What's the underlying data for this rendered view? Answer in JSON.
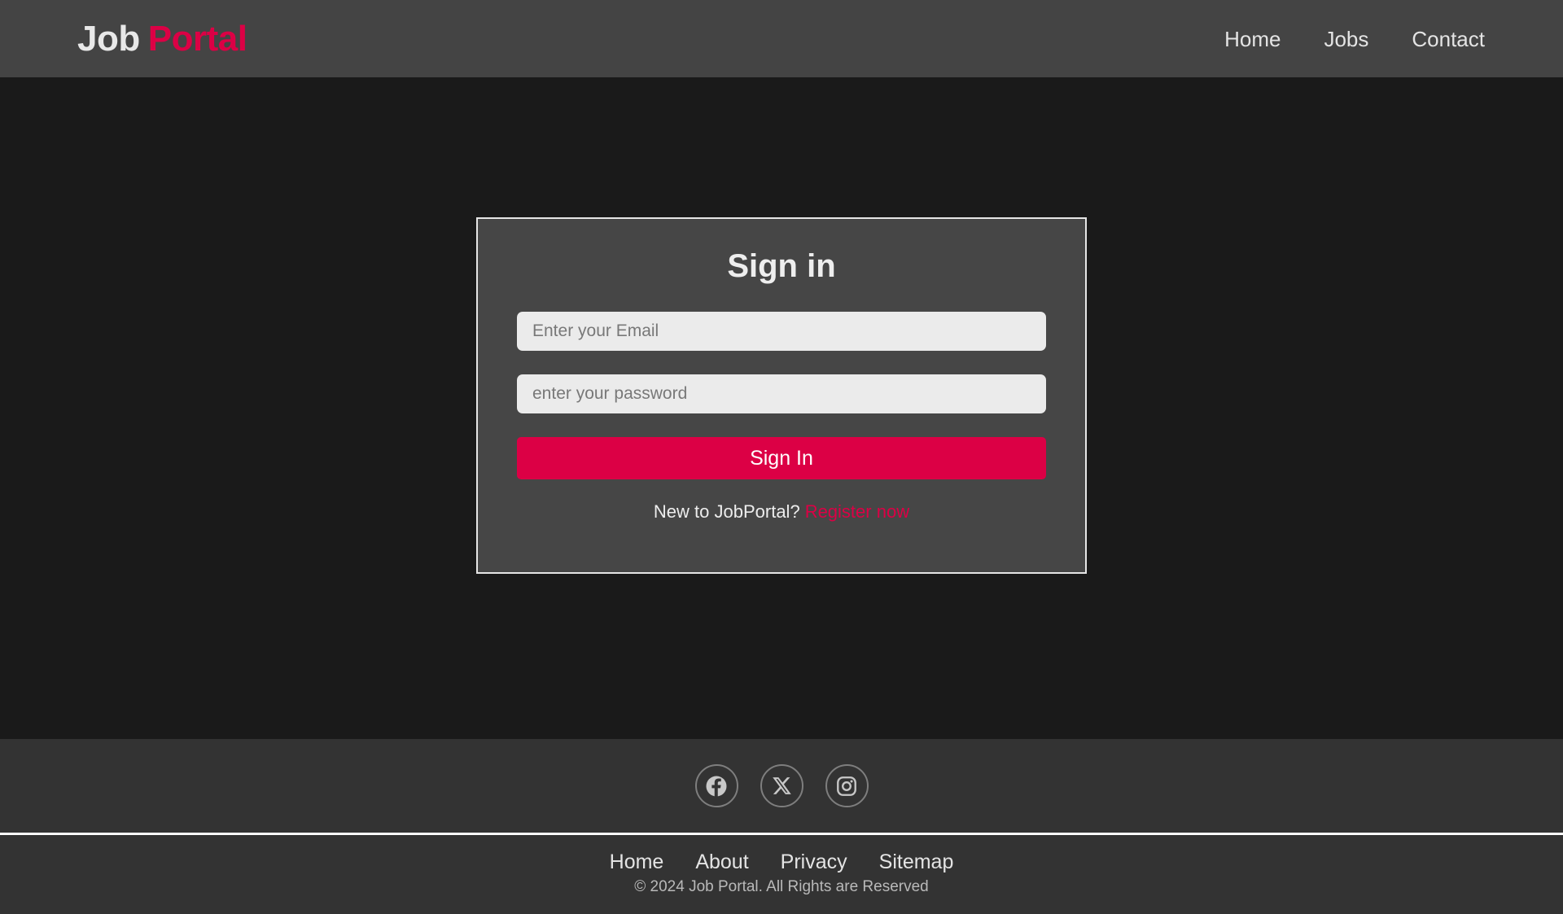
{
  "header": {
    "brand": {
      "primary": "Job",
      "accent": "Portal"
    },
    "nav": [
      {
        "label": "Home",
        "name": "nav-link-home"
      },
      {
        "label": "Jobs",
        "name": "nav-link-jobs"
      },
      {
        "label": "Contact",
        "name": "nav-link-contact"
      }
    ]
  },
  "signin": {
    "title": "Sign in",
    "email": {
      "placeholder": "Enter your Email",
      "value": ""
    },
    "password": {
      "placeholder": "enter your password",
      "value": ""
    },
    "submit_label": "Sign In",
    "register_prompt": "New to JobPortal?",
    "register_link": "Register now"
  },
  "footer": {
    "social": [
      {
        "icon": "facebook-icon",
        "label": "Facebook"
      },
      {
        "icon": "x-twitter-icon",
        "label": "X"
      },
      {
        "icon": "instagram-icon",
        "label": "Instagram"
      }
    ],
    "links": [
      {
        "label": "Home"
      },
      {
        "label": "About"
      },
      {
        "label": "Privacy"
      },
      {
        "label": "Sitemap"
      }
    ],
    "copyright": "© 2024 Job Portal. All Rights are Reserved"
  },
  "colors": {
    "accent": "#dc0045",
    "page_background": "#1a1a1a",
    "header_background": "#444444",
    "footer_background": "#333333",
    "card_background": "#464646",
    "input_background": "#ebebeb"
  }
}
